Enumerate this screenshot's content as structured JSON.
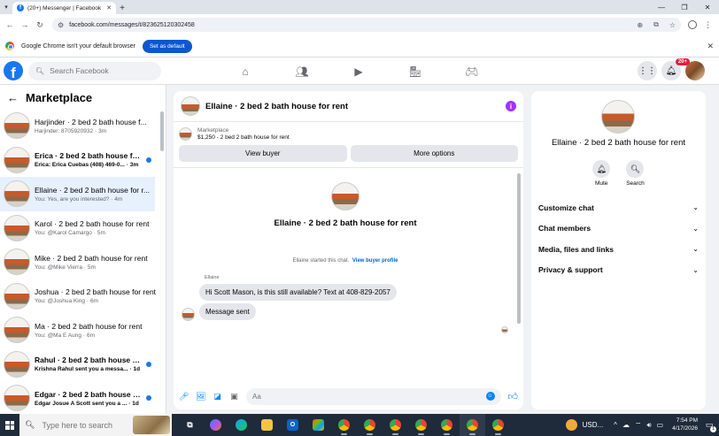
{
  "browser": {
    "tab_title": "(20+) Messenger | Facebook",
    "url": "facebook.com/messages/t/823625120302458",
    "infobar_message": "Google Chrome isn't your default browser",
    "infobar_button": "Set as default"
  },
  "facebook": {
    "logo_letter": "f",
    "search_placeholder": "Search Facebook",
    "notifications_badge": "20+"
  },
  "marketplace": {
    "heading": "Marketplace",
    "conversations": [
      {
        "name": "Harjinder · 2 bed 2 bath house f...",
        "snippet": "Harjinder: 8705920932 ·",
        "time": "3m",
        "unread": false
      },
      {
        "name": "Erica · 2 bed 2 bath house for r...",
        "snippet": "Erica: Erica Cuebas (408) 469-0...",
        "time": "· 3m",
        "unread": true
      },
      {
        "name": "Ellaine · 2 bed 2 bath house for r...",
        "snippet": "You: Yes, are you interested? ·",
        "time": "4m",
        "unread": false
      },
      {
        "name": "Karol · 2 bed 2 bath house for rent",
        "snippet": "You: @Karol Camargo ·",
        "time": "5m",
        "unread": false
      },
      {
        "name": "Mike · 2 bed 2 bath house for rent",
        "snippet": "You: @Mike Vierra ·",
        "time": "5m",
        "unread": false
      },
      {
        "name": "Joshua · 2 bed 2 bath house for rent",
        "snippet": "You: @Joshua King ·",
        "time": "6m",
        "unread": false
      },
      {
        "name": "Ma · 2 bed 2 bath house for rent",
        "snippet": "You: @Ma E Aung ·",
        "time": "6m",
        "unread": false
      },
      {
        "name": "Rahul · 2 bed 2 bath house for ...",
        "snippet": "Krishna Rahul sent you a messa...",
        "time": "· 1d",
        "unread": true
      },
      {
        "name": "Edgar · 2 bed 2 bath house for ...",
        "snippet": "Edgar Josue A Scott sent you a ...",
        "time": "· 1d",
        "unread": true
      }
    ]
  },
  "chat": {
    "title": "Ellaine · 2 bed 2 bath house for rent",
    "listing_label": "Marketplace",
    "listing_detail": "$1,250 - 2 bed 2 bath house for rent",
    "view_buyer": "View buyer",
    "more_options": "More options",
    "intro_name": "Ellaine · 2 bed 2 bath house for rent",
    "started_text": "Ellaine started this chat.",
    "view_buyer_profile": "View buyer profile",
    "sender_label": "Ellaine",
    "messages": [
      "Hi Scott Mason, is this still available? Text at 408-829-2057",
      "Message sent"
    ],
    "composer_placeholder": "Aa"
  },
  "details": {
    "name": "Ellaine · 2 bed 2 bath house for rent",
    "mute_label": "Mute",
    "search_label": "Search",
    "menu": [
      "Customize chat",
      "Chat members",
      "Media, files and links",
      "Privacy & support"
    ]
  },
  "taskbar": {
    "search_placeholder": "Type here to search",
    "currency": "USD...",
    "time": "7:54 PM",
    "date": "4/17/2026",
    "notification_count": "1"
  },
  "colors": {
    "facebook_blue": "#1877f2",
    "messenger_blue": "#0084ff",
    "info_purple": "#a033ff",
    "active_row": "#e7f0fd",
    "taskbar": "#1f2a3a"
  }
}
